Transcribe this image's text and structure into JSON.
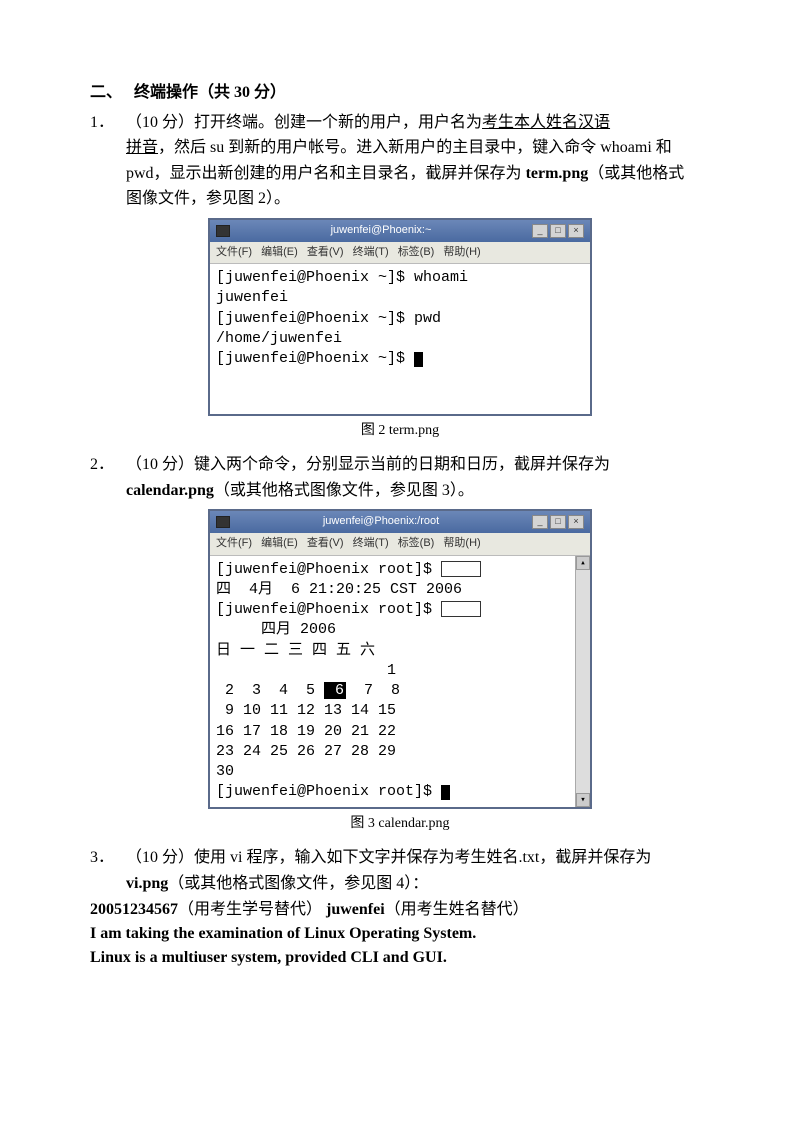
{
  "section": {
    "number": "二、",
    "title": "终端操作（共 30 分）"
  },
  "q1": {
    "num": "1．",
    "pts": "（10 分）",
    "t1": "打开终端。创建一个新的用户，用户名为",
    "u1": "考生本人姓名汉语",
    "u2": "拼音",
    "t2": "，然后 su 到新的用户帐号。进入新用户的主目录中，键入命令 whoami 和 pwd，显示出新创建的用户名和主目录名，截屏并保存为",
    "b1": "term.png",
    "t3": "（或其他格式图像文件，参见图 2）。"
  },
  "term1": {
    "title": "juwenfei@Phoenix:~",
    "menu": [
      "文件(F)",
      "编辑(E)",
      "查看(V)",
      "终端(T)",
      "标签(B)",
      "帮助(H)"
    ],
    "lines": [
      "[juwenfei@Phoenix ~]$ whoami",
      "juwenfei",
      "[juwenfei@Phoenix ~]$ pwd",
      "/home/juwenfei",
      "[juwenfei@Phoenix ~]$ "
    ]
  },
  "cap1": "图 2 term.png",
  "q2": {
    "num": "2．",
    "pts": "（10 分）",
    "t1": "键入两个命令，分别显示当前的日期和日历，截屏并保存为",
    "b1": "calendar.png",
    "t2": "（或其他格式图像文件，参见图 3）。"
  },
  "term2": {
    "title": "juwenfei@Phoenix:/root",
    "menu": [
      "文件(F)",
      "编辑(E)",
      "查看(V)",
      "终端(T)",
      "标签(B)",
      "帮助(H)"
    ],
    "prompt1": "[juwenfei@Phoenix root]$ ",
    "date": "四  4月  6 21:20:25 CST 2006",
    "prompt2": "[juwenfei@Phoenix root]$ ",
    "cal_title": "     四月 2006",
    "cal_head": "日 一 二 三 四 五 六",
    "cal_r1": "                   1",
    "cal_r2a": " 2  3  4  5 ",
    "cal_r2_hi": " 6",
    "cal_r2b": "  7  8",
    "cal_r3": " 9 10 11 12 13 14 15",
    "cal_r4": "16 17 18 19 20 21 22",
    "cal_r5": "23 24 25 26 27 28 29",
    "cal_r6": "30",
    "prompt3": "[juwenfei@Phoenix root]$ "
  },
  "cap2": "图 3 calendar.png",
  "q3": {
    "num": "3．",
    "pts": "（10 分）",
    "t1": "使用 vi 程序，输入如下文字并保存为考生姓名.txt，截屏并保存为 ",
    "b1": "vi.png",
    "t2": "（或其他格式图像文件，参见图 4）："
  },
  "vi": {
    "l1a": "20051234567",
    "l1b": "（用考生学号替代）  ",
    "l1c": "juwenfei",
    "l1d": "（用考生姓名替代）",
    "l2": "I am taking the examination of Linux Operating System.",
    "l3": "Linux is a multiuser system, provided CLI and GUI."
  },
  "winbtns": {
    "min": "_",
    "max": "□",
    "close": "×"
  },
  "scroll": {
    "up": "▴",
    "down": "▾"
  }
}
